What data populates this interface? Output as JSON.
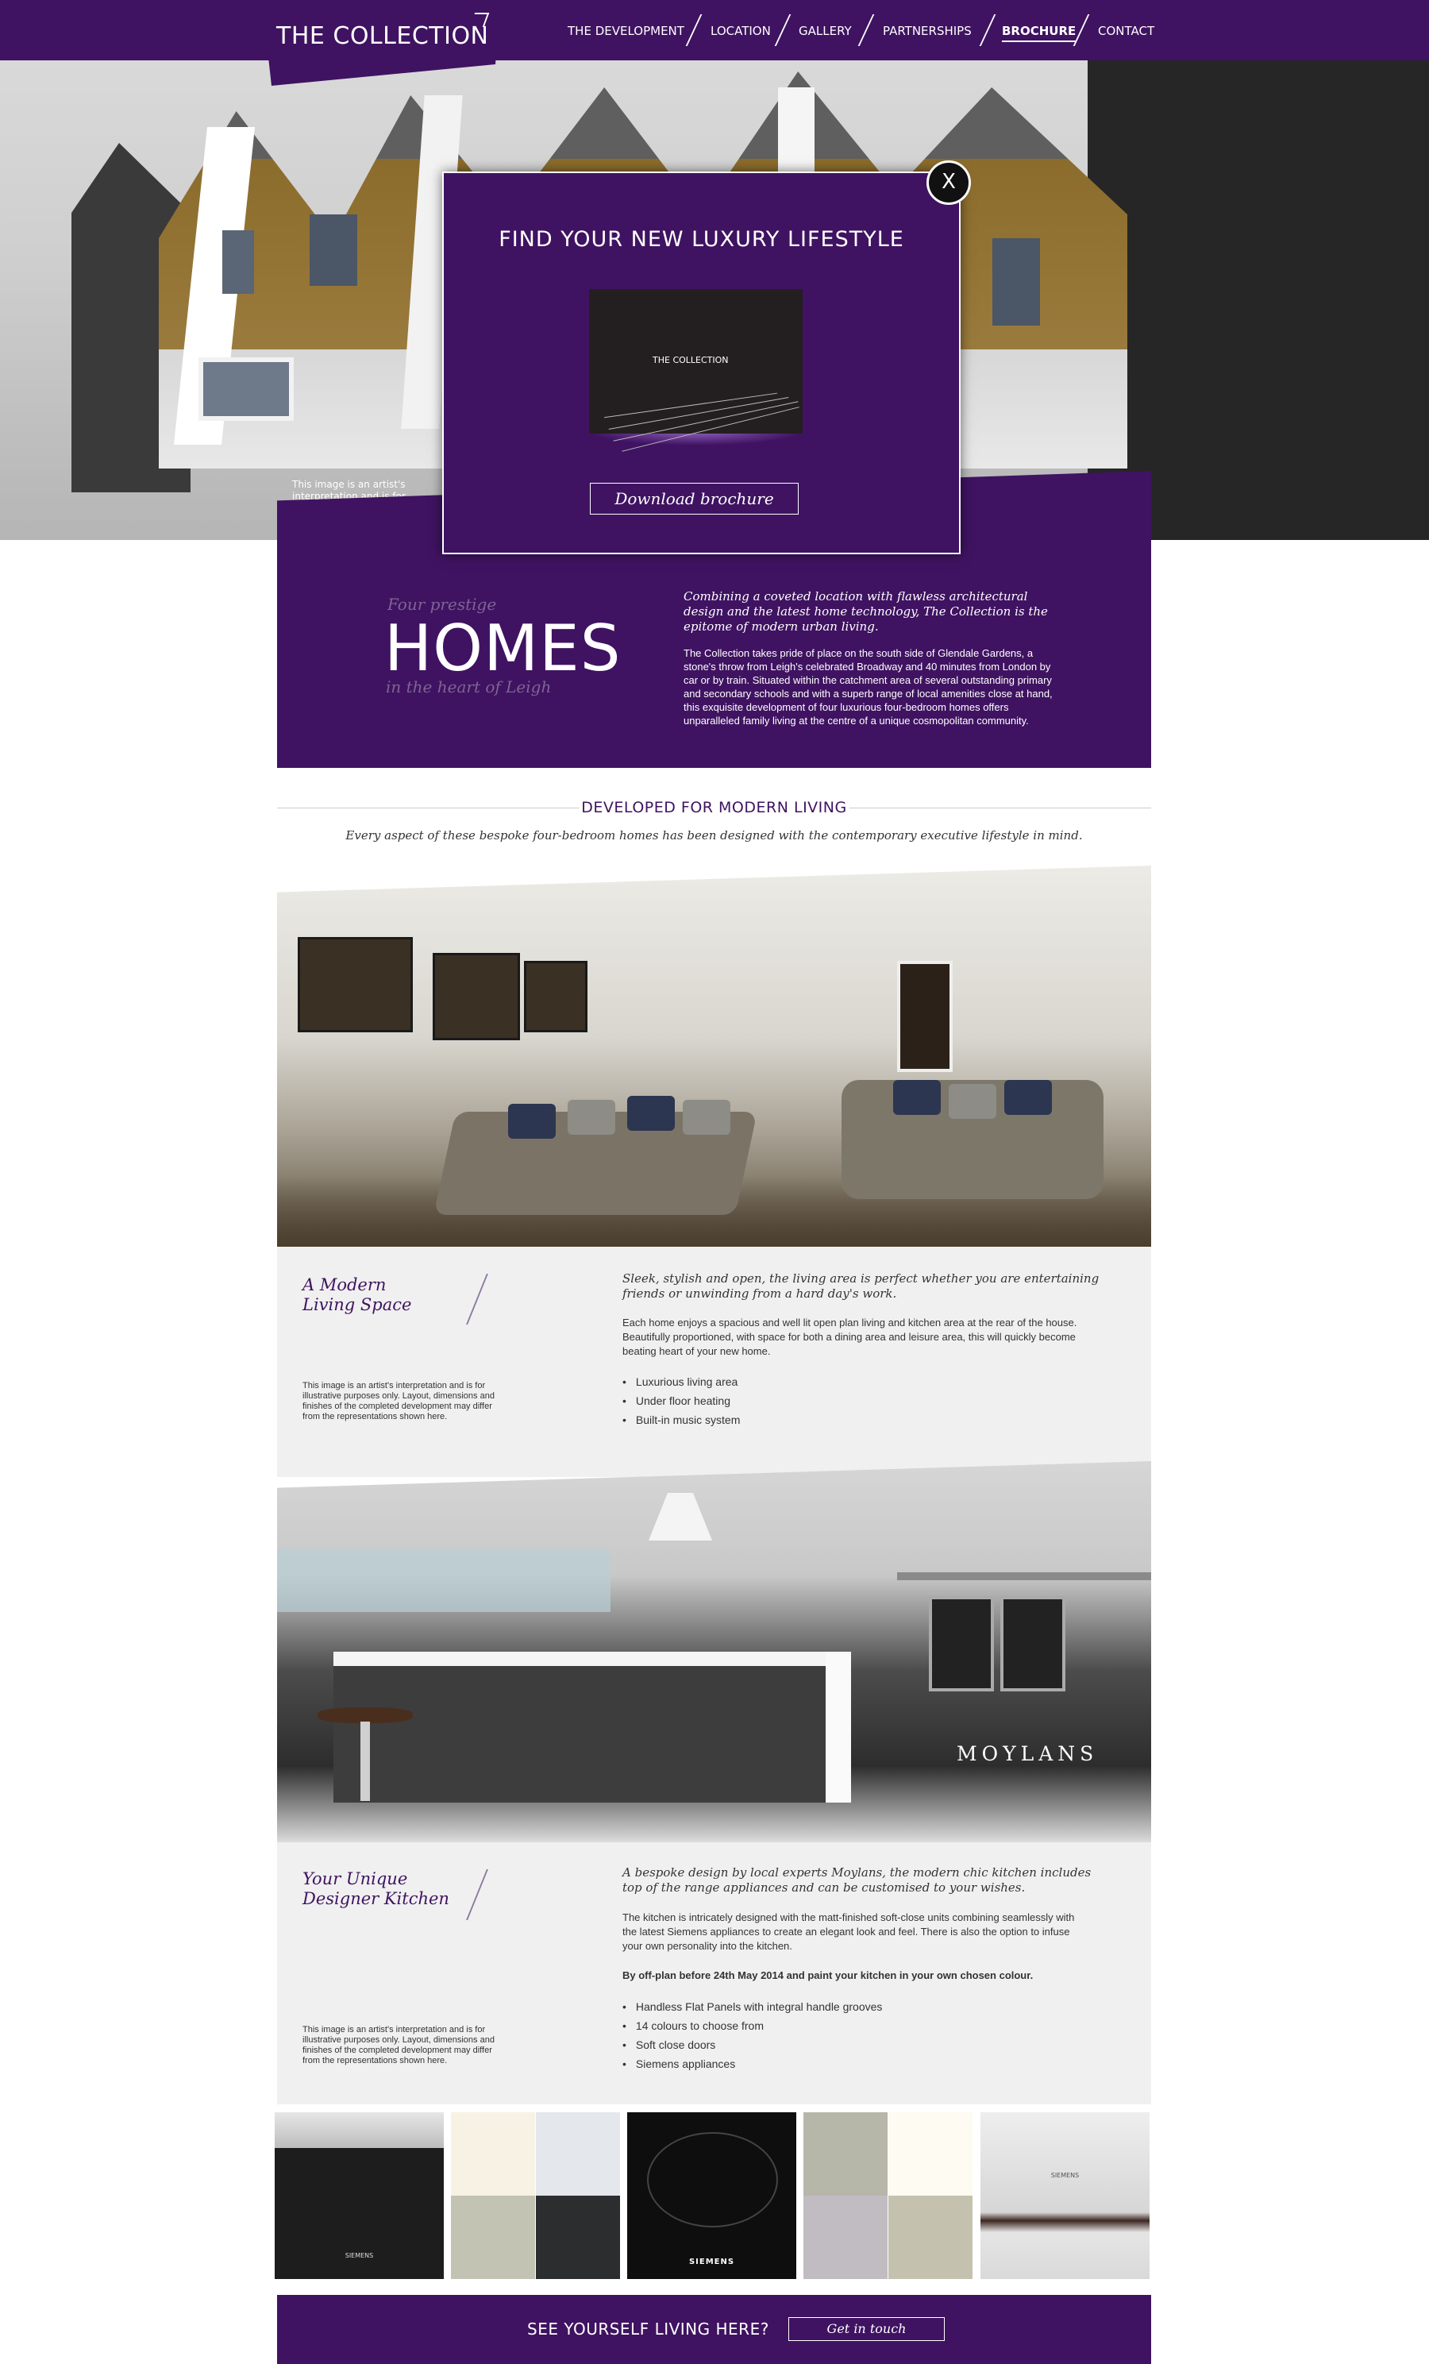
{
  "brand": {
    "logo_text": "THE COLLECTION",
    "purple": "#3f1361"
  },
  "nav": {
    "items": [
      {
        "label": "THE DEVELOPMENT",
        "active": false
      },
      {
        "label": "LOCATION",
        "active": false
      },
      {
        "label": "GALLERY",
        "active": false
      },
      {
        "label": "PARTNERSHIPS",
        "active": false
      },
      {
        "label": "BROCHURE",
        "active": true
      },
      {
        "label": "CONTACT",
        "active": false
      }
    ]
  },
  "hero": {
    "disclaimer": "This image is an artist's interpretation and is for illustrative purposes only."
  },
  "modal": {
    "title": "FIND YOUR NEW LUXURY LIFESTYLE",
    "cover_title": "THE COLLECTION",
    "button_label": "Download brochure",
    "close_label": "X",
    "close_icon": "close-icon"
  },
  "intro": {
    "small_top": "Four prestige",
    "big": "HOMES",
    "small_bottom": "in the heart of Leigh",
    "lead": "Combining a coveted location with flawless architectural design and the latest home technology, The Collection is the epitome of modern urban living.",
    "body": "The Collection takes pride of place on the south side of Glendale Gardens, a stone's throw from Leigh's celebrated Broadway and 40 minutes from London by car or by train. Situated within the catchment area of several outstanding primary and secondary schools and with a superb range of local amenities close at hand, this exquisite development of four luxurious four-bedroom homes offers unparalleled family living at the centre of a unique cosmopolitan community."
  },
  "section": {
    "heading": "DEVELOPED FOR MODERN LIVING",
    "subheading": "Every aspect of these bespoke four-bedroom homes has been designed with the contemporary executive lifestyle in mind."
  },
  "living": {
    "title_line1": "A Modern",
    "title_line2": "Living Space",
    "disclaimer": "This image is an artist's interpretation and is for illustrative purposes only. Layout, dimensions and finishes of the completed development may differ from the representations shown here.",
    "lead": "Sleek, stylish and open, the living area is perfect whether you are entertaining friends or unwinding from a hard day's work.",
    "body": "Each home enjoys a spacious and well lit open plan living and kitchen area at the rear of the house. Beautifully proportioned, with space for both a dining area and leisure area, this will quickly become beating heart of your new home.",
    "bullets": [
      "Luxurious living area",
      "Under floor heating",
      "Built-in music system"
    ]
  },
  "kitchen": {
    "brand_watermark": "MOYLANS",
    "title_line1": "Your Unique",
    "title_line2": "Designer Kitchen",
    "disclaimer": "This image is an artist's interpretation and is for illustrative purposes only. Layout, dimensions and finishes of the completed development may differ from the representations shown here.",
    "lead": "A bespoke design by local experts Moylans, the modern chic kitchen includes top of the range appliances and can be customised to your wishes.",
    "body": "The kitchen is intricately designed with the matt-finished soft-close units combining seamlessly with the latest Siemens appliances to create an elegant look and feel. There is also the option to infuse your own personality into the kitchen.",
    "offer": "By off-plan before 24th May 2014 and paint your kitchen in your own chosen colour.",
    "bullets": [
      "Handless Flat Panels with integral handle grooves",
      "14 colours to choose from",
      "Soft close doors",
      "Siemens appliances"
    ]
  },
  "gallery": {
    "oven_brand": "SIEMENS",
    "hob_brand": "SIEMENS",
    "hood_brand": "SIEMENS",
    "swatches_1": [
      "#f7f2e3",
      "#e4e8ec",
      "#c3c3b3",
      "#2c2d2f"
    ],
    "swatches_2": [
      "#b6b6a9",
      "#fdfbf2",
      "#c0bcc2",
      "#c4c2ae"
    ]
  },
  "cta": {
    "text": "SEE YOURSELF LIVING HERE?",
    "button_label": "Get in touch"
  }
}
